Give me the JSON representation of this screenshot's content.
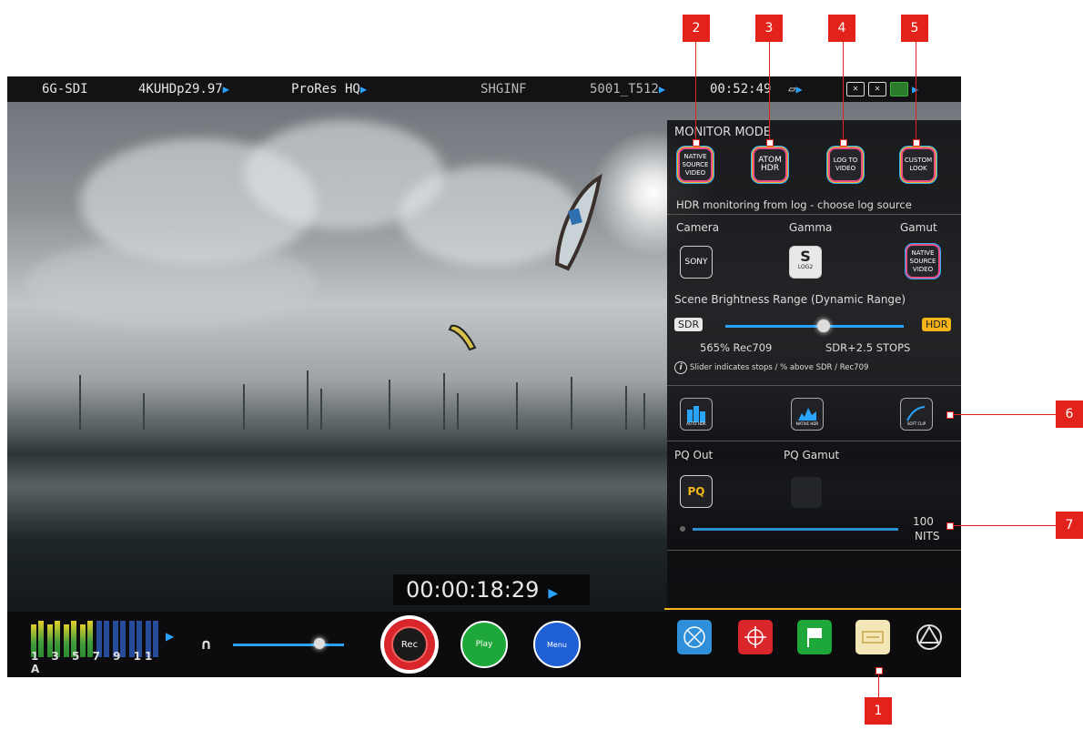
{
  "status_bar": {
    "input": "6G-SDI",
    "format": "4KUHDp29.97",
    "codec": "ProRes HQ",
    "drive": "SHGINF",
    "clip": "5001_T512",
    "time_remaining": "00:52:49"
  },
  "monitor_mode": {
    "title": "MONITOR MODE",
    "buttons": [
      {
        "label": "NATIVE SOURCE VIDEO",
        "icon": "native-source-video-icon"
      },
      {
        "label": "ATOM HDR",
        "icon": "atom-hdr-icon"
      },
      {
        "label": "LOG TO VIDEO",
        "icon": "log-to-video-icon"
      },
      {
        "label": "CUSTOM LOOK",
        "icon": "custom-look-icon"
      }
    ],
    "hint": "HDR monitoring from log - choose log source"
  },
  "source": {
    "camera_label": "Camera",
    "gamma_label": "Gamma",
    "gamut_label": "Gamut",
    "camera_value": "SONY",
    "gamma_value": "S",
    "gamma_sub": "LOG2",
    "gamut_value": "NATIVE SOURCE VIDEO"
  },
  "dynamic_range": {
    "title": "Scene Brightness Range (Dynamic Range)",
    "sdr_tag": "SDR",
    "hdr_tag": "HDR",
    "slider_position": 0.55,
    "rec709": "565% Rec709",
    "stops": "SDR+2.5 STOPS",
    "info": "Slider indicates stops / % above SDR / Rec709"
  },
  "hdr_tools": [
    {
      "label": "AUTO HDR",
      "icon": "auto-hdr-icon"
    },
    {
      "label": "NATIVE HDR",
      "icon": "native-hdr-icon"
    },
    {
      "label": "SOFT CLIP",
      "icon": "soft-clip-icon"
    }
  ],
  "pq": {
    "out_label": "PQ Out",
    "gamut_label": "PQ Gamut",
    "out_value": "PQ",
    "nits_value": "100",
    "nits_unit": "NITS"
  },
  "timecode": "00:00:18:29",
  "audio": {
    "channel_labels": "1 3 5 7 9 11 A",
    "volume_level": 0.78
  },
  "transport": {
    "rec_label": "Rec",
    "play_label": "Play",
    "menu_label": "Menu"
  },
  "callouts": [
    "1",
    "2",
    "3",
    "4",
    "5",
    "6",
    "7"
  ],
  "colors": {
    "accent_blue": "#2aa3ff",
    "rec_red": "#d8262b",
    "play_green": "#1fa83a",
    "menu_blue": "#1e5fd6",
    "hdr_yellow": "#f4b41a",
    "callout_red": "#e3231b"
  }
}
